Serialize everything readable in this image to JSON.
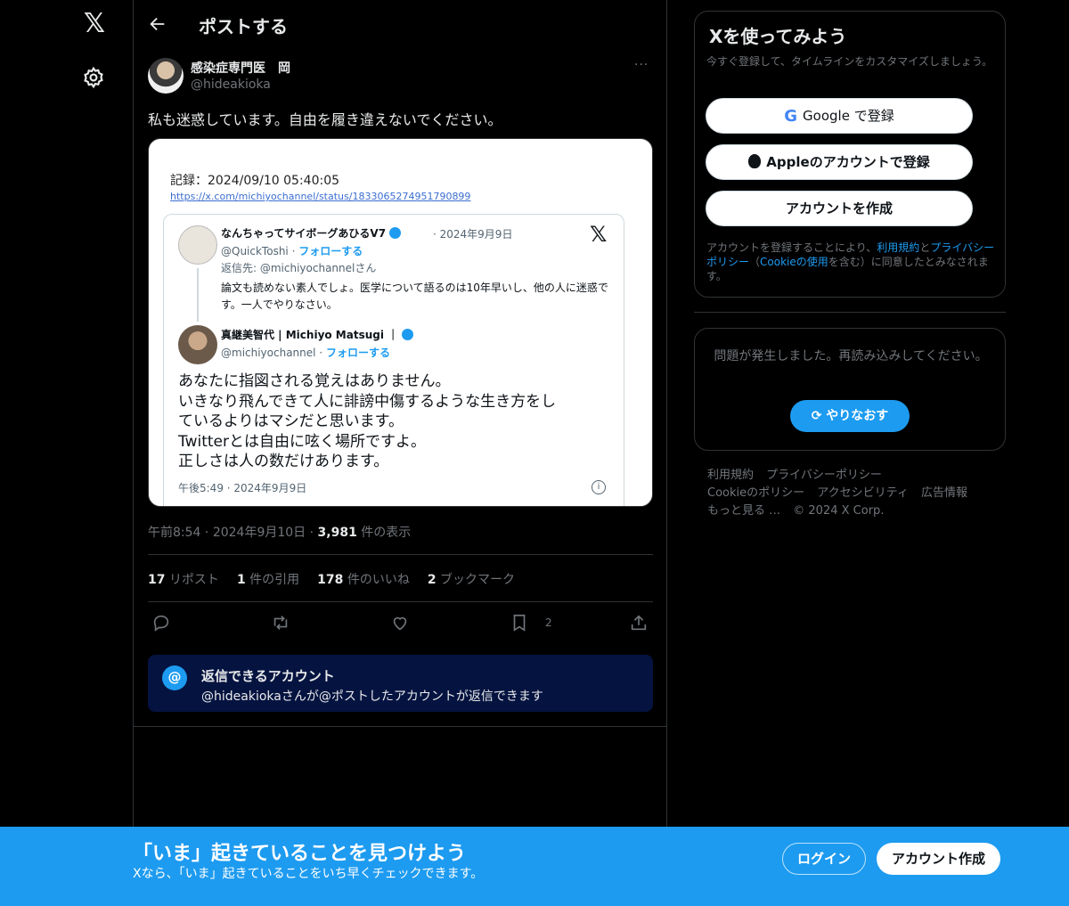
{
  "nav": {
    "logo": "𝕏"
  },
  "header": {
    "title": "ポストする"
  },
  "post": {
    "author_name": "感染症専門医　岡",
    "author_handle": "@hideakioka",
    "more": "···",
    "text": "私も迷惑しています。自由を履き違えないでください。",
    "meta_time": "午前8:54",
    "meta_date": "2024年9月10日",
    "views_count": "3,981",
    "views_label": "件の表示",
    "stats": [
      {
        "count": "17",
        "label": "リポスト"
      },
      {
        "count": "1",
        "label": "件の引用"
      },
      {
        "count": "178",
        "label": "件のいいね"
      },
      {
        "count": "2",
        "label": "ブックマーク"
      }
    ],
    "bookmark_count": "2"
  },
  "media": {
    "record_label": "記録：2024/09/10 05:40:05",
    "record_url": "https://x.com/michiyochannel/status/1833065274951790899",
    "x_logo": "𝕏",
    "tweet1": {
      "name": "なんちゃってサイボーグあひるV7",
      "date": "· 2024年9月9日",
      "handle": "@QuickToshi · ",
      "follow": "フォローする",
      "reply_to": "返信先: @michiyochannelさん",
      "body": "論文も読めない素人でしょ。医学について語るのは10年早いし、他の人に迷惑です。一人でやりなさい。"
    },
    "tweet2": {
      "name": "真継美智代 | Michiyo Matsugi ｜",
      "handle": "@michiyochannel · ",
      "follow": "フォローする",
      "body_lines": [
        "あなたに指図される覚えはありません。",
        "いきなり飛んできて人に誹謗中傷するような生き方をし",
        "ているよりはマシだと思います。",
        "Twitterとは自由に呟く場所ですよ。",
        "正しさは人の数だけあります。"
      ],
      "time": "午後5:49 · 2024年9月9日",
      "info": "i"
    }
  },
  "reply_box": {
    "icon": "@",
    "title": "返信できるアカウント",
    "subtitle": "@hideakiokaさんが@ポストしたアカウントが返信できます"
  },
  "signup": {
    "title": "Xを使ってみよう",
    "desc": "今すぐ登録して、タイムラインをカスタマイズしましょう。",
    "google_icon": "G",
    "google_label": "Google で登録",
    "apple_label": "Appleのアカウントで登録",
    "create_label": "アカウントを作成",
    "legal_1": "アカウントを登録することにより、",
    "legal_terms": "利用規約",
    "legal_2": "と",
    "legal_privacy": "プライバシーポリシー",
    "legal_3": "（",
    "legal_cookie": "Cookieの使用",
    "legal_4": "を含む）に同意したとみなされます。"
  },
  "error": {
    "text": "問題が発生しました。再読み込みしてください。",
    "retry_label": "やりなおす"
  },
  "footer": {
    "row1": [
      "利用規約",
      "プライバシーポリシー"
    ],
    "row2": [
      "Cookieのポリシー",
      "アクセシビリティ",
      "広告情報"
    ],
    "row3": [
      "もっと見る …",
      "© 2024 X Corp."
    ]
  },
  "bottom_bar": {
    "title": "「いま」起きていることを見つけよう",
    "subtitle": "Xなら、「いま」起きていることをいち早くチェックできます。",
    "login": "ログイン",
    "signup": "アカウント作成"
  },
  "colors": {
    "accent": "#1d9bf0",
    "bg": "#000000",
    "reply_box": "#051340"
  }
}
